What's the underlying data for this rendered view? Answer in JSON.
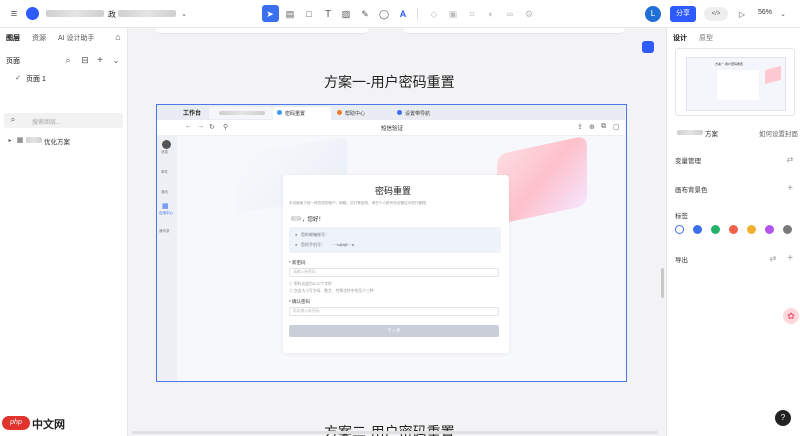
{
  "topbar": {
    "file_name_suffix": "政",
    "share_label": "分享",
    "code_label": "</>",
    "zoom": "56%",
    "avatar_initial": "L"
  },
  "left": {
    "tabs": [
      "图层",
      "资源",
      "AI 设计助手"
    ],
    "pages_label": "页面",
    "page_item": "页面 1",
    "search_placeholder": "搜索图层...",
    "layer_item": "优化方案"
  },
  "canvas": {
    "title1": "方案一-用户密码重置",
    "title2": "方案二-用户密码重置",
    "frame": {
      "app_title": "工作台",
      "tabs": [
        "密码重置",
        "帮助中心",
        "设置带导航"
      ],
      "nav_title": "短信验证",
      "side_items": [
        "消息",
        "邮件",
        "通讯",
        "应用中心",
        "通讯录"
      ],
      "card_title": "密码重置",
      "card_subtitle": "本页面用于统一修改您的账户、邮箱、钉钉等密码，请在个人账号安全管控中进行管理。",
      "greeting": "，您好！",
      "info_account_label": "您的邮箱账号：",
      "info_phone_label": "您的手机号：",
      "info_phone_value": "···rq5i@···a",
      "new_pwd_label": "* 新密码",
      "new_pwd_placeholder": "请输入新密码",
      "rule1": "① 密码长度为8-20个字符",
      "rule2": "② 包含大小写字母、数字、特殊字符中的至少三种",
      "confirm_label": "* 确认密码",
      "confirm_placeholder": "再次输入新密码",
      "submit": "下一步"
    }
  },
  "right": {
    "tabs": [
      "设计",
      "原型"
    ],
    "thumb_caption": "方案",
    "thumb_link": "如何设置封面",
    "thumb_inner_title": "方案一-用户密码重置",
    "sections": [
      "变量管理",
      "画布背景色",
      "标签",
      "导出"
    ],
    "tag_colors": [
      "#ffffff",
      "#3b6ff0",
      "#23b26a",
      "#f0604a",
      "#f1b030",
      "#b353f0",
      "#7a7a7a"
    ]
  },
  "watermark": "中文网"
}
